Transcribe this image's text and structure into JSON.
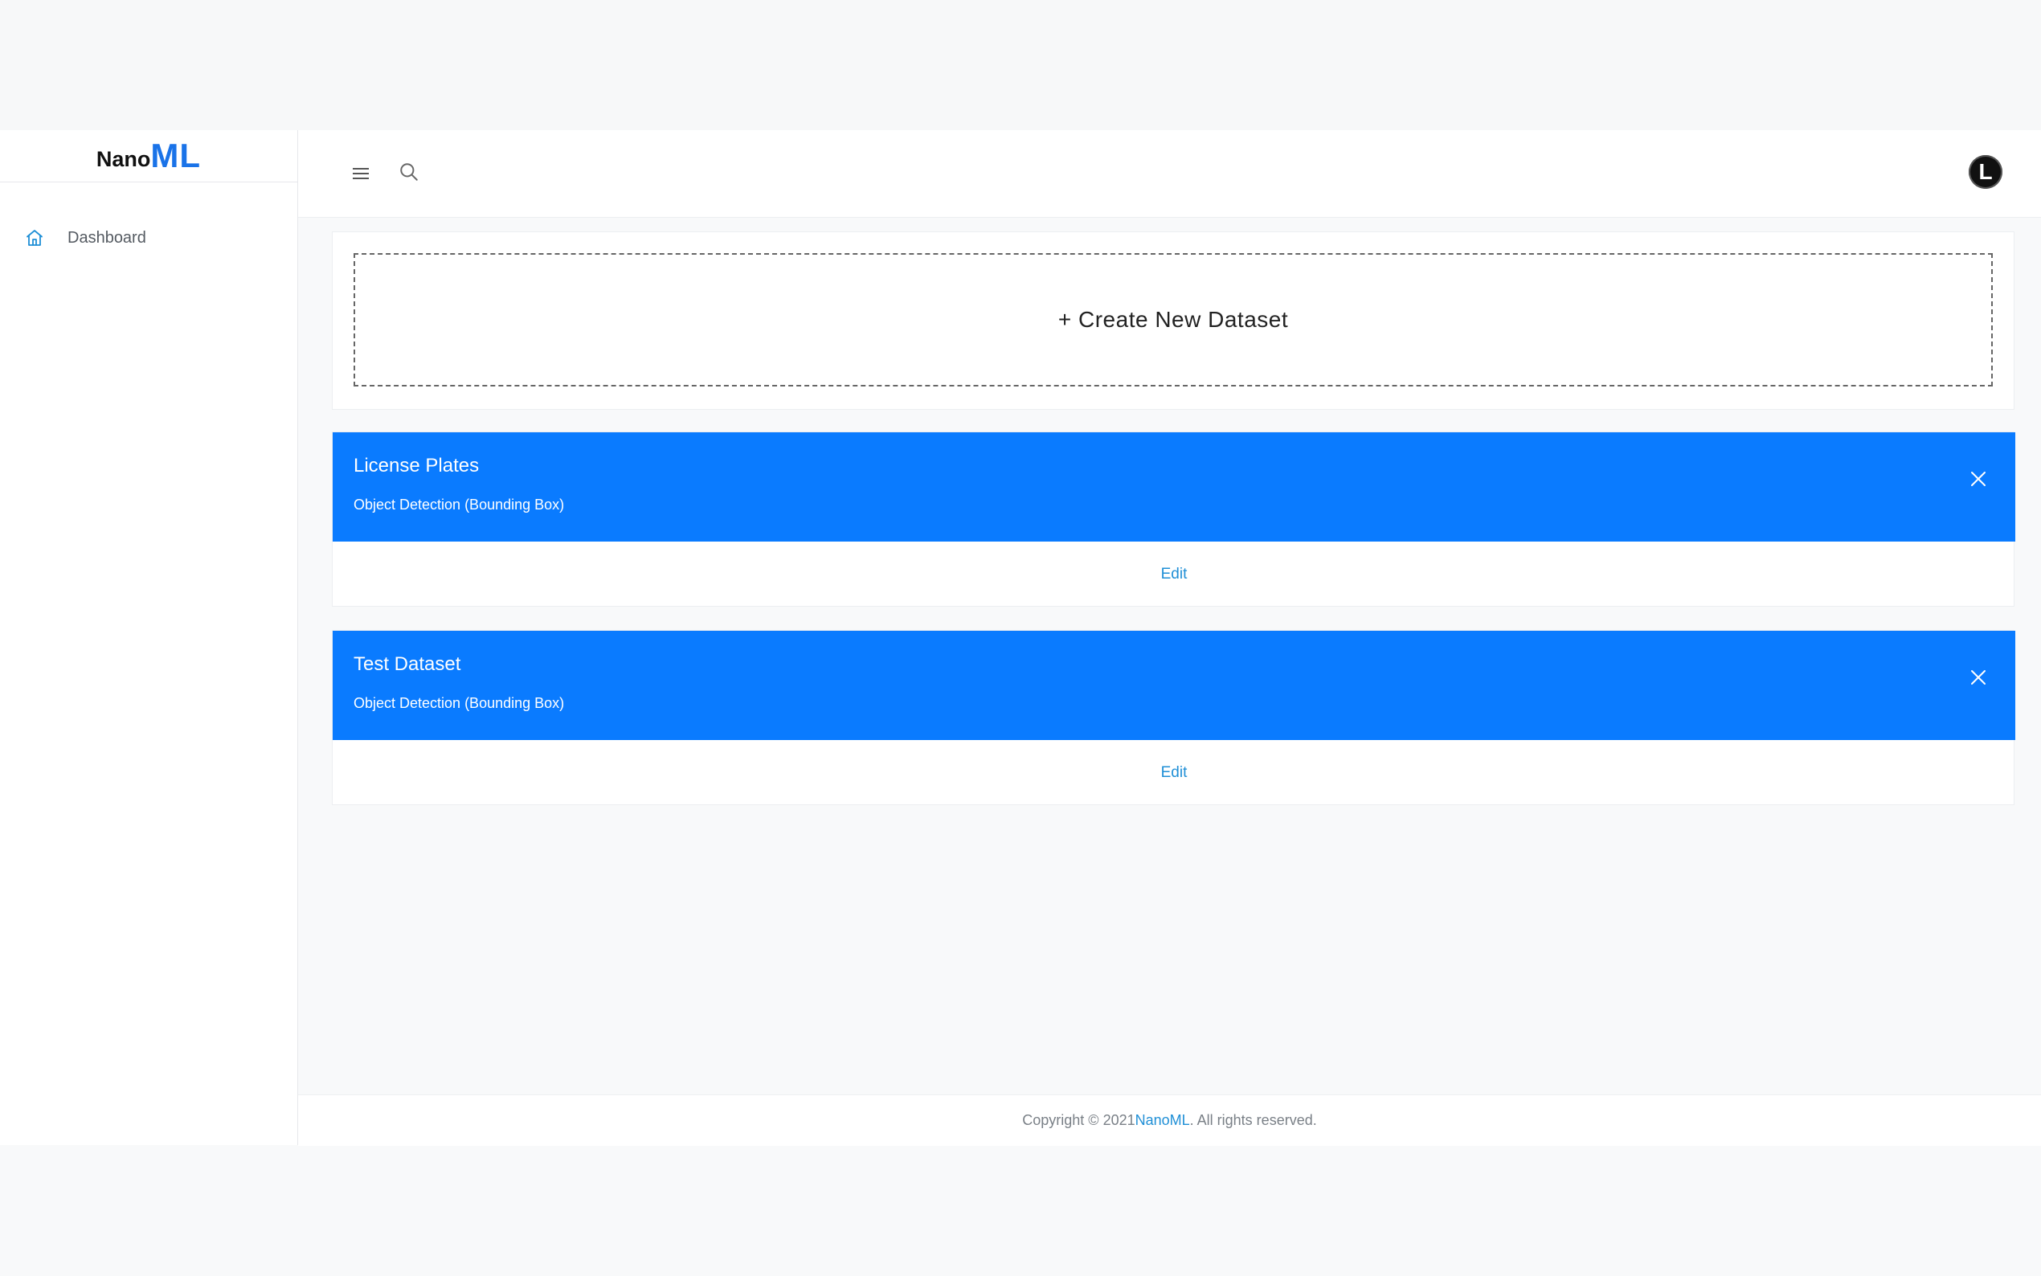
{
  "brand": {
    "nano": "Nano",
    "ml": "ML"
  },
  "sidebar": {
    "items": [
      {
        "label": "Dashboard",
        "icon": "home-icon"
      }
    ]
  },
  "header": {
    "menu_icon": "hamburger-menu-icon",
    "search_icon": "search-icon",
    "avatar_initial": "L"
  },
  "create_card": {
    "label": "+ Create New Dataset"
  },
  "datasets": [
    {
      "title": "License Plates",
      "type": "Object Detection (Bounding Box)",
      "edit_label": "Edit"
    },
    {
      "title": "Test Dataset",
      "type": "Object Detection (Bounding Box)",
      "edit_label": "Edit"
    }
  ],
  "footer": {
    "prefix": "Copyright © 2021 ",
    "link": "NanoML",
    "suffix": ". All rights reserved."
  },
  "colors": {
    "accent": "#0a7bff",
    "link": "#1f8fd6",
    "brand_ml": "#1a73e8"
  }
}
